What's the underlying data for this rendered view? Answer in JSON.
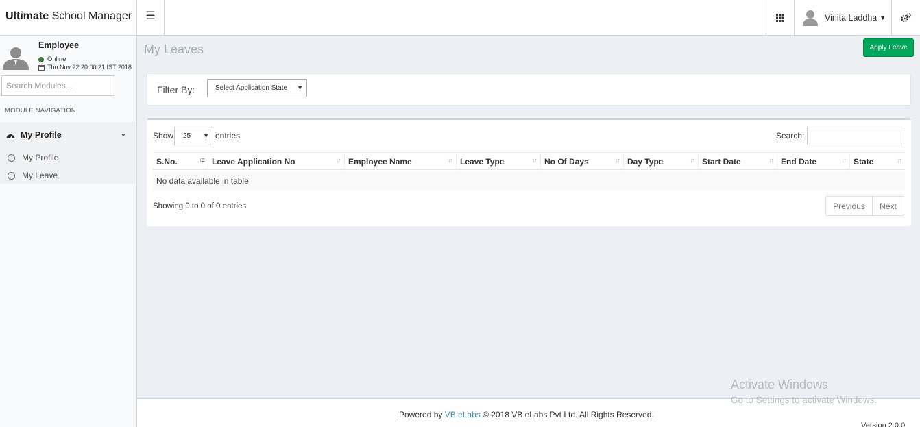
{
  "header": {
    "logo_bold": "Ultimate",
    "logo_rest": " School Manager",
    "menu_icon": "hamburger-icon",
    "user_name": "Vinita Laddha"
  },
  "sidebar": {
    "role": "Employee",
    "status": "Online",
    "datetime": "Thu Nov 22 20:00:21 IST 2018",
    "search_placeholder": "Search Modules...",
    "nav_header": "MODULE NAVIGATION",
    "group_label": "My Profile",
    "items": [
      {
        "label": "My Profile"
      },
      {
        "label": "My Leave"
      }
    ]
  },
  "main": {
    "title": "My Leaves",
    "apply_button": "Apply Leave",
    "filter_label": "Filter By:",
    "filter_select": "Select Application State",
    "show_label": "Show",
    "page_length": "25",
    "entries_label": "entries",
    "search_label": "Search:",
    "columns": [
      "S.No.",
      "Leave Application No",
      "Employee Name",
      "Leave Type",
      "No Of Days",
      "Day Type",
      "Start Date",
      "End Date",
      "State"
    ],
    "empty_message": "No data available in table",
    "info": "Showing 0 to 0 of 0 entries",
    "prev_label": "Previous",
    "next_label": "Next"
  },
  "footer": {
    "powered_by": "Powered by ",
    "company_link": "VB eLabs",
    "copyright": " © 2018 VB eLabs Pvt Ltd. All Rights Reserved.",
    "version": "Version 2.0.0"
  },
  "watermark": {
    "line1": "Activate Windows",
    "line2": "Go to Settings to activate Windows."
  },
  "colors": {
    "accent_green": "#00a65a",
    "link_blue": "#3c8dbc",
    "background": "#ecf0f5"
  }
}
